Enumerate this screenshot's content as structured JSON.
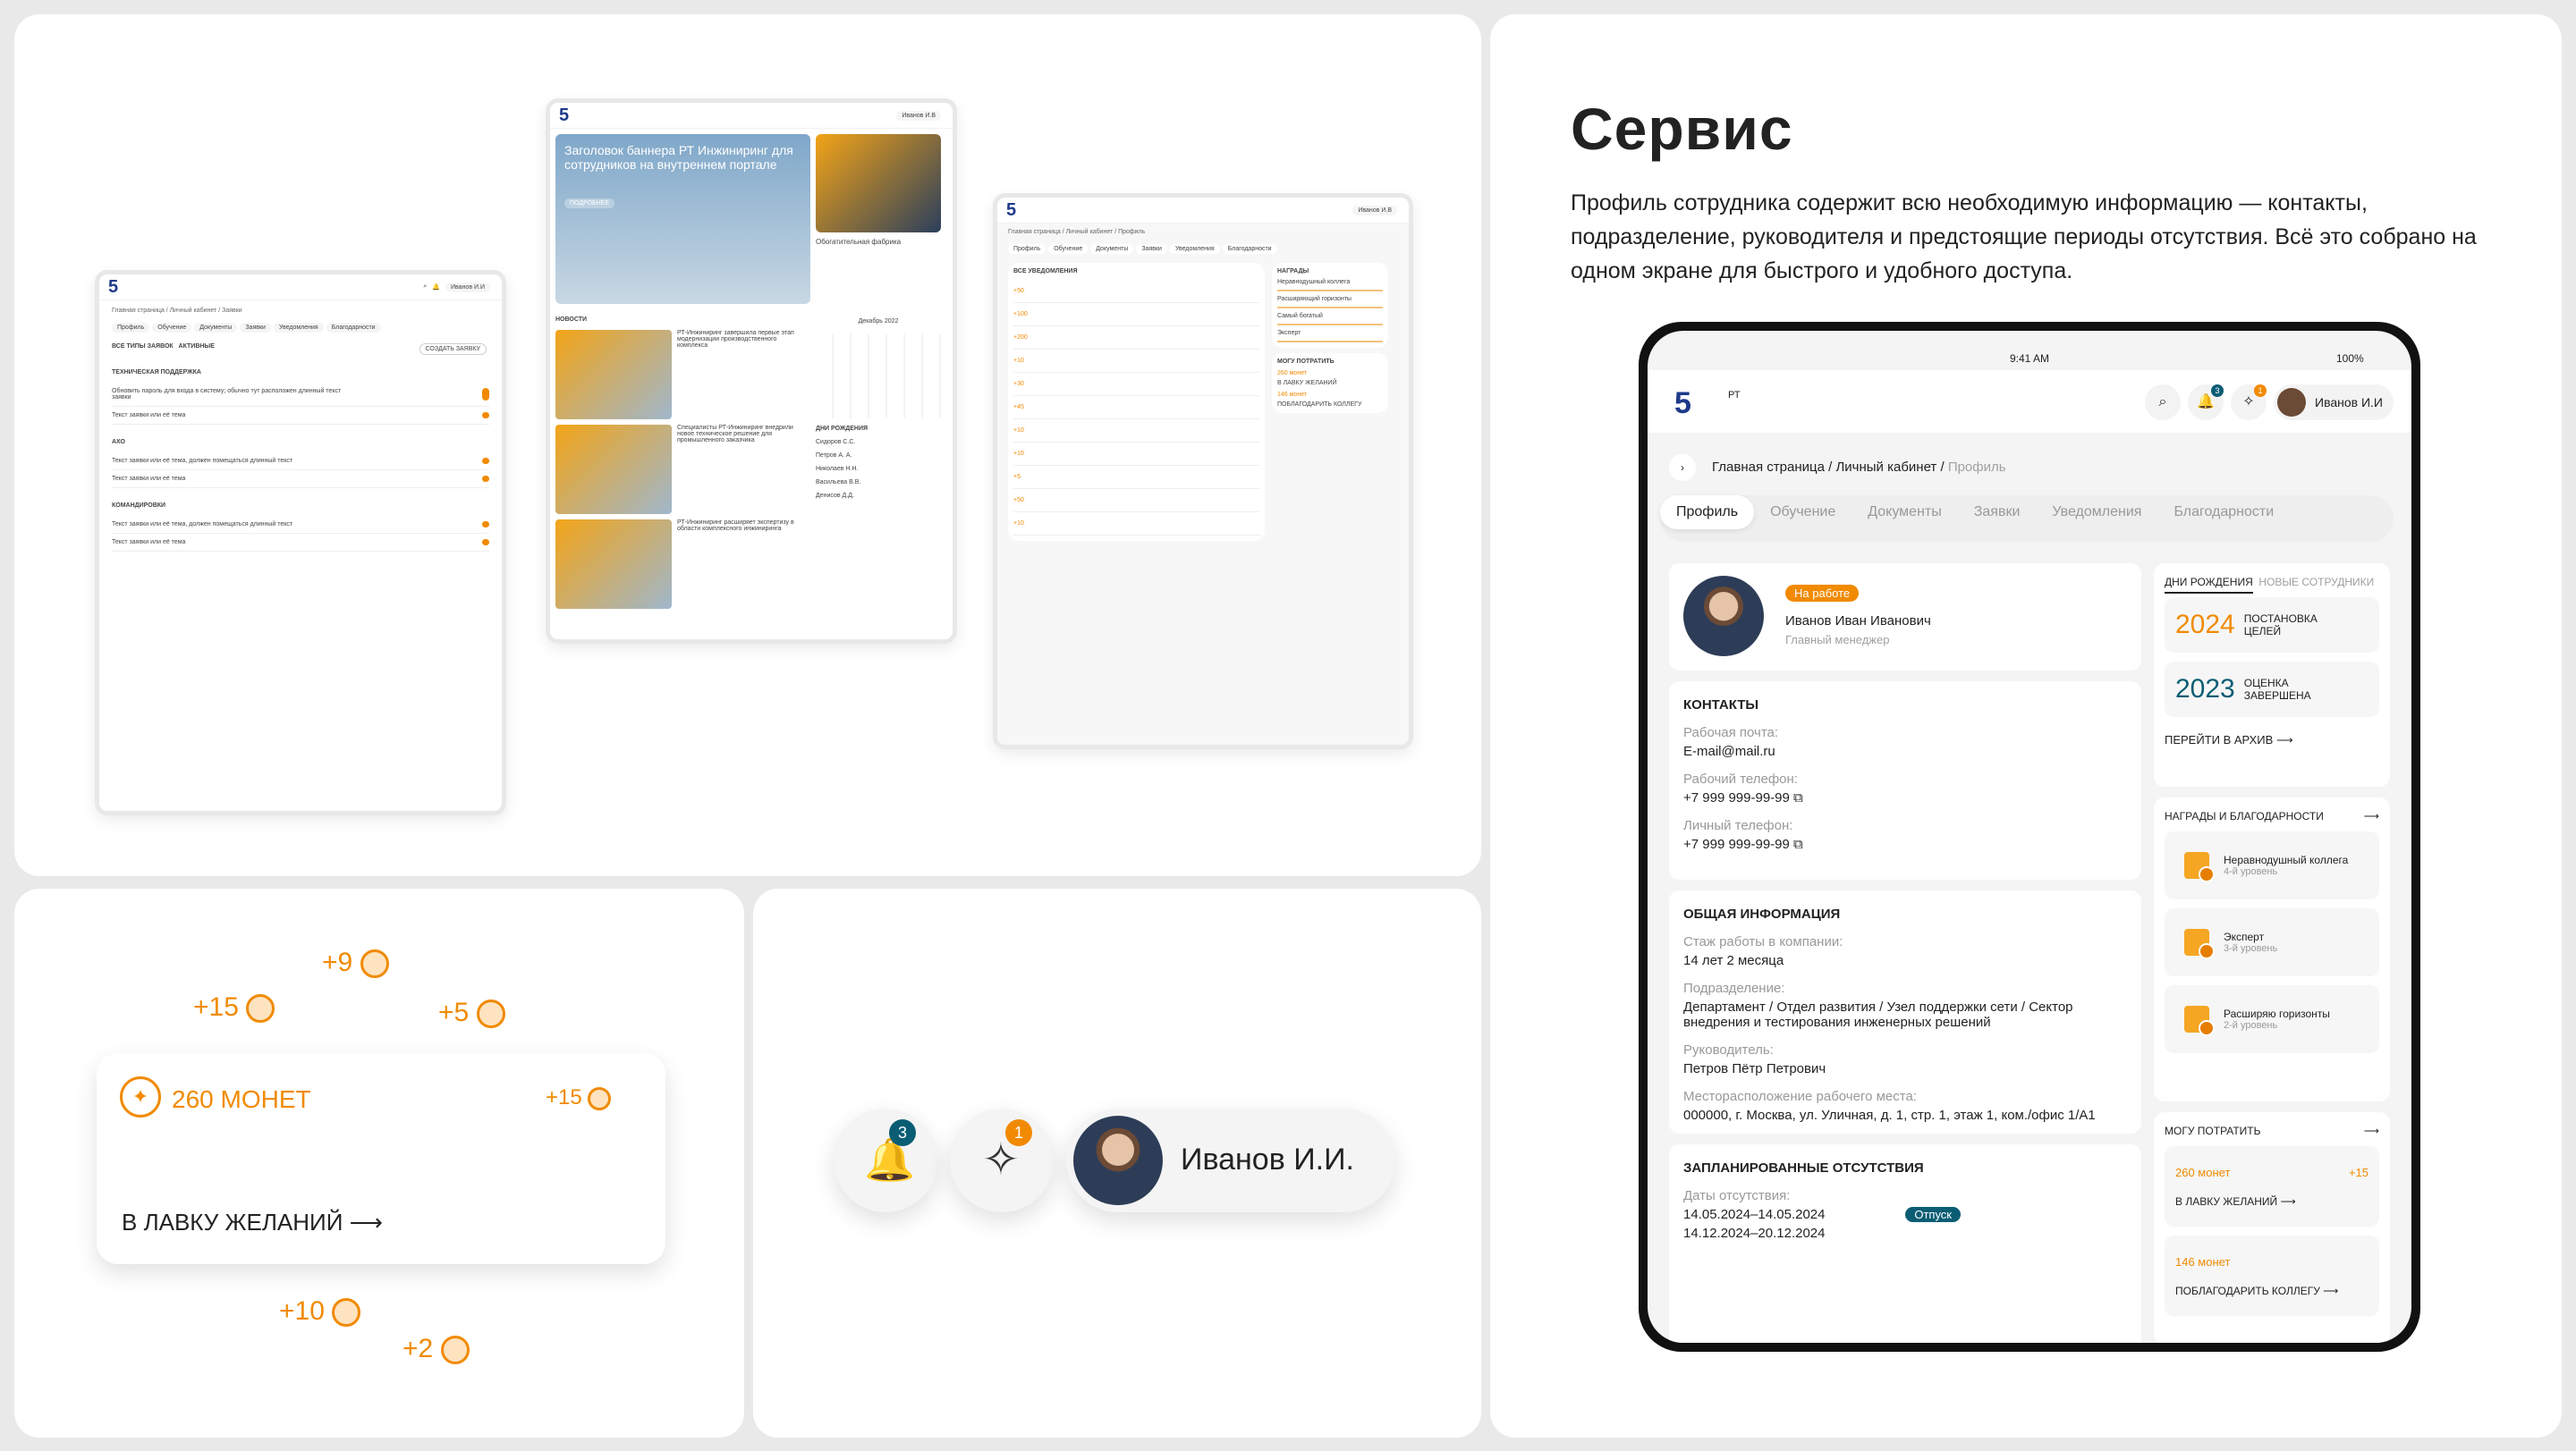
{
  "colors": {
    "accent": "#f18a00",
    "brand": "#1e3a8a",
    "status_green": "#0b7a75"
  },
  "service": {
    "title": "Сервис",
    "description": "Профиль сотрудника содержит всю необходимую информацию — контакты, подразделение, руководителя и предстоящие периоды отсутствия. Всё это собрано на одном экране для быстрого и удобного доступа."
  },
  "coins": {
    "floats": [
      "+9",
      "+15",
      "+5",
      "+10",
      "+2"
    ],
    "card_amount": "260 МОНЕТ",
    "card_bonus": "+15",
    "card_link": "В ЛАВКУ ЖЕЛАНИЙ"
  },
  "header_widget": {
    "notif_count": "3",
    "star_count": "1",
    "user": "Иванов И.И."
  },
  "tablet": {
    "status_time": "9:41 AM",
    "status_battery": "100%",
    "logo_brand": "РТ",
    "user": "Иванов И.И",
    "notif_count": "3",
    "star_count": "1",
    "breadcrumb": [
      "Главная страница",
      "Личный кабинет",
      "Профиль"
    ],
    "tabs": [
      "Профиль",
      "Обучение",
      "Документы",
      "Заявки",
      "Уведомления",
      "Благодарности"
    ],
    "tab_badges": {
      "notifications": "3",
      "thanks": "1"
    },
    "profile": {
      "status": "На работе",
      "name": "Иванов Иван Иванович",
      "position": "Главный менеджер"
    },
    "contacts": {
      "title": "КОНТАКТЫ",
      "fields": [
        {
          "label": "Рабочая почта:",
          "value": "E-mail@mail.ru"
        },
        {
          "label": "Рабочий телефон:",
          "value": "+7 999 999-99-99"
        },
        {
          "label": "Личный телефон:",
          "value": "+7 999 999-99-99"
        }
      ]
    },
    "general": {
      "title": "ОБЩАЯ ИНФОРМАЦИЯ",
      "fields": [
        {
          "label": "Стаж работы в компании:",
          "value": "14 лет 2 месяца"
        },
        {
          "label": "Подразделение:",
          "value": "Департамент / Отдел развития / Узел поддержки сети / Сектор внедрения и тестирования инженерных решений"
        },
        {
          "label": "Руководитель:",
          "value": "Петров Пётр Петрович"
        },
        {
          "label": "Месторасположение рабочего места:",
          "value": "000000, г. Москва, ул. Уличная, д. 1, стр. 1, этаж 1, ком./офис 1/А1"
        }
      ]
    },
    "absences": {
      "title": "ЗАПЛАНИРОВАННЫЕ ОТСУТСТВИЯ",
      "label": "Даты отсутствия:",
      "dates": "14.05.2024–14.05.2024",
      "type": "Отпуск",
      "next_dates": "14.12.2024–20.12.2024"
    },
    "side": {
      "tab_birthdays": "ДНИ РОЖДЕНИЯ",
      "tab_new": "НОВЫЕ СОТРУДНИКИ",
      "goals": [
        {
          "year": "2024",
          "text": "ПОСТАНОВКА ЦЕЛЕЙ"
        },
        {
          "year": "2023",
          "text": "ОЦЕНКА ЗАВЕРШЕНА"
        }
      ],
      "archive_link": "ПЕРЕЙТИ В АРХИВ",
      "awards_title": "НАГРАДЫ И БЛАГОДАРНОСТИ",
      "awards": [
        {
          "name": "Неравнодушный коллега",
          "level": "4-й уровень"
        },
        {
          "name": "Эксперт",
          "level": "3-й уровень"
        },
        {
          "name": "Расширяю горизонты",
          "level": "2-й уровень"
        }
      ],
      "spend_title": "МОГУ ПОТРАТИТЬ",
      "spend_coins": "260 монет",
      "spend_bonus": "+15",
      "spend_link": "В ЛАВКУ ЖЕЛАНИЙ",
      "thank_coins": "146 монет",
      "thank_link": "ПОБЛАГОДАРИТЬ КОЛЛЕГУ"
    }
  },
  "mock_requests": {
    "user": "Иванов И.И",
    "breadcrumb": "Главная страница / Личный кабинет / Заявки",
    "tabs": [
      "Профиль",
      "Обучение",
      "Документы",
      "Заявки",
      "Уведомления",
      "Благодарности"
    ],
    "filters": [
      "ВСЕ ТИПЫ ЗАЯВОК",
      "АКТИВНЫЕ"
    ],
    "create": "СОЗДАТЬ ЗАЯВКУ",
    "groups": [
      {
        "title": "ТЕХНИЧЕСКАЯ ПОДДЕРЖКА",
        "rows": [
          "Обновить пароль для входа в систему; обычно тут расположен длинный текст заявки",
          "Текст заявки или её тема"
        ]
      },
      {
        "title": "АХО",
        "rows": [
          "Текст заявки или её тема, должен помещаться длинный текст",
          "Текст заявки или её тема"
        ]
      },
      {
        "title": "КОМАНДИРОВКИ",
        "rows": [
          "Текст заявки или её тема, должен помещаться длинный текст",
          "Текст заявки или её тема"
        ]
      }
    ]
  },
  "mock_news": {
    "user": "Иванов И.В",
    "banner_title": "Заголовок баннера РТ Инжиниринг для сотрудников на внутреннем портале",
    "banner_btn": "ПОДРОБНЕЕ",
    "side_title": "Обогатительная фабрика",
    "news_title": "НОВОСТИ",
    "news": [
      "РТ-Инжиниринг завершила первые этап модернизации производственного комплекса",
      "Специалисты РТ-Инжиниринг внедрили новое техническое решение для промышленного заказчика",
      "РТ-Инжиниринг расширяет экспертизу в области комплексного инжиниринга"
    ],
    "calendar_month": "Декабрь",
    "calendar_year": "2022",
    "birthdays": "ДНИ РОЖДЕНИЯ",
    "people": [
      "Сидоров С.С.",
      "Петров А. А.",
      "Николаев Н.Н.",
      "Васильева В.В.",
      "Денисов Д.Д."
    ]
  },
  "mock_notifications": {
    "user": "Иванов И.В",
    "breadcrumb": "Главная страница / Личный кабинет / Профиль",
    "tabs": [
      "Профиль",
      "Обучение",
      "Документы",
      "Заявки",
      "Уведомления",
      "Благодарности"
    ],
    "filter": "ВСЕ УВЕДОМЛЕНИЯ",
    "rewards": "НАГРАДЫ",
    "rewards_items": [
      "Неравнодушный коллега",
      "Расширяющий горизонты",
      "Самый богатый",
      "Эксперт"
    ],
    "spend": "МОГУ ПОТРАТИТЬ",
    "coins1": "260 монет",
    "coins2": "146 монет",
    "link1": "В ЛАВКУ ЖЕЛАНИЙ",
    "link2": "ПОБЛАГОДАРИТЬ КОЛЛЕГУ",
    "amounts": [
      "+50",
      "+100",
      "+200",
      "+10",
      "+30",
      "+45",
      "+10",
      "+10",
      "+5",
      "+50",
      "+10"
    ]
  }
}
